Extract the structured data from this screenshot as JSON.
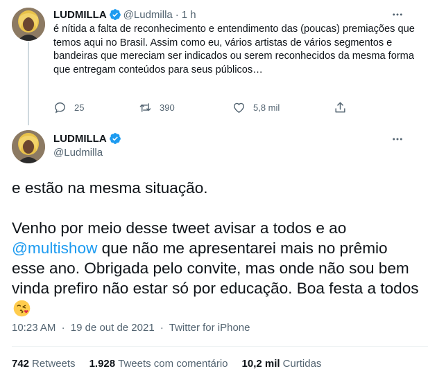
{
  "parent_tweet": {
    "display_name": "LUDMILLA",
    "handle": "@Ludmilla",
    "separator": "·",
    "time_ago": "1 h",
    "text": "é nítida a falta de reconhecimento e entendimento das (poucas) premiações que temos aqui no Brasil. Assim como eu, vários artistas de vários segmentos e bandeiras que mereciam ser indicados ou serem reconhecidos da mesma forma que entregam conteúdos para seus públicos…",
    "reply_count": "25",
    "retweet_count": "390",
    "like_count": "5,8 mil"
  },
  "main_tweet": {
    "display_name": "LUDMILLA",
    "handle": "@Ludmilla",
    "text_line1": "e estão na mesma situação.",
    "text_before_mention": "Venho por meio desse tweet avisar a todos e ao ",
    "mention": "@multishow",
    "text_after_mention": " que não me apresentarei mais no prêmio esse ano. Obrigada pelo convite, mas onde não sou bem vinda prefiro não estar só por educação. Boa festa a todos ",
    "emoji": "kissing-face-with-heart-emoji",
    "time": "10:23 AM",
    "date": "19 de out de 2021",
    "separator": "·",
    "source": "Twitter for iPhone",
    "retweets_count": "742",
    "retweets_label": "Retweets",
    "quote_count": "1.928",
    "quote_label": "Tweets com comentário",
    "likes_count": "10,2 mil",
    "likes_label": "Curtidas"
  },
  "colors": {
    "accent": "#1d9bf0",
    "text": "#0f1419",
    "muted": "#536471",
    "divider": "#eff3f4",
    "thread_line": "#cfd9de"
  }
}
